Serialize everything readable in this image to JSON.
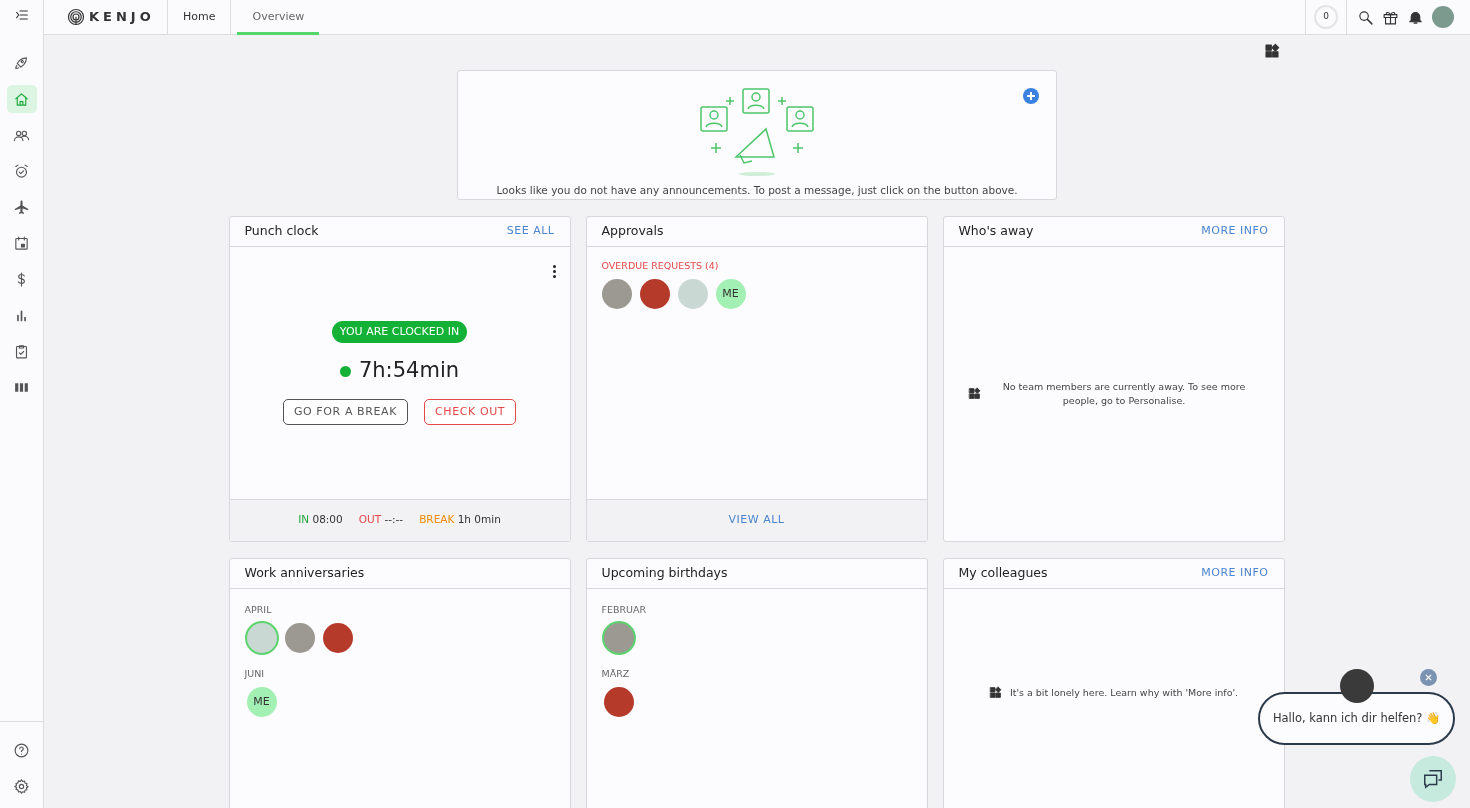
{
  "sidebar": {
    "items": [
      {
        "kind": "rocket",
        "selected": false
      },
      {
        "kind": "home",
        "selected": true
      },
      {
        "kind": "people",
        "selected": false
      },
      {
        "kind": "alarm",
        "selected": false
      },
      {
        "kind": "plane",
        "selected": false
      },
      {
        "kind": "calendar",
        "selected": false
      },
      {
        "kind": "dollar",
        "selected": false
      },
      {
        "kind": "chart",
        "selected": false
      },
      {
        "kind": "clipboard",
        "selected": false
      },
      {
        "kind": "columns",
        "selected": false
      }
    ],
    "bottom_items": [
      {
        "kind": "help"
      },
      {
        "kind": "settings"
      }
    ]
  },
  "topbar": {
    "logo": "KENJO",
    "tabs": [
      {
        "label": "Home",
        "selected": false
      },
      {
        "label": "Overview",
        "selected": true
      }
    ],
    "counter": "0"
  },
  "announcements": {
    "message": "Looks like you do not have any announcements. To post a message, just click on the button above."
  },
  "widgets": [
    {
      "kind": "punch",
      "title": "Punch clock",
      "link": "SEE ALL",
      "status": "YOU ARE CLOCKED IN",
      "time": "7h:54min",
      "buttons": [
        {
          "label": "GO FOR A BREAK",
          "kind": "neutral"
        },
        {
          "label": "CHECK OUT",
          "kind": "danger"
        }
      ],
      "footer": [
        {
          "label": "IN",
          "value": "08:00",
          "color": "#21a53b"
        },
        {
          "label": "OUT",
          "value": "--:--",
          "color": "#e54848"
        },
        {
          "label": "BREAK",
          "value": "1h 0min",
          "color": "#f08a00"
        }
      ]
    },
    {
      "kind": "approvals",
      "title": "Approvals",
      "section": "OVERDUE REQUESTS (4)",
      "avatars": [
        {
          "kind": "photo",
          "highlighted": false
        },
        {
          "kind": "photo",
          "highlighted": false
        },
        {
          "kind": "photo",
          "highlighted": false
        },
        {
          "kind": "initials",
          "text": "ME",
          "highlighted": false
        }
      ],
      "footer_link": "VIEW ALL"
    },
    {
      "kind": "empty",
      "title": "Who's away",
      "link": "MORE INFO",
      "message": "No team members are currently away. To see more people, go to Personalise."
    },
    {
      "kind": "groups",
      "title": "Work anniversaries",
      "groups": [
        {
          "label": "APRIL",
          "avatars": [
            {
              "kind": "photo",
              "highlighted": true
            },
            {
              "kind": "photo",
              "highlighted": false
            },
            {
              "kind": "photo",
              "highlighted": false
            }
          ]
        },
        {
          "label": "JUNI",
          "avatars": [
            {
              "kind": "initials",
              "text": "ME",
              "highlighted": false
            }
          ]
        }
      ]
    },
    {
      "kind": "groups",
      "title": "Upcoming birthdays",
      "groups": [
        {
          "label": "FEBRUAR",
          "avatars": [
            {
              "kind": "photo",
              "highlighted": true
            }
          ]
        },
        {
          "label": "MÄRZ",
          "avatars": [
            {
              "kind": "photo",
              "highlighted": false
            }
          ]
        }
      ]
    },
    {
      "kind": "empty",
      "title": "My colleagues",
      "link": "MORE INFO",
      "message": "It's a bit lonely here. Learn why with 'More info'."
    }
  ],
  "chat": {
    "message": "Hallo, kann ich dir helfen? 👋"
  }
}
